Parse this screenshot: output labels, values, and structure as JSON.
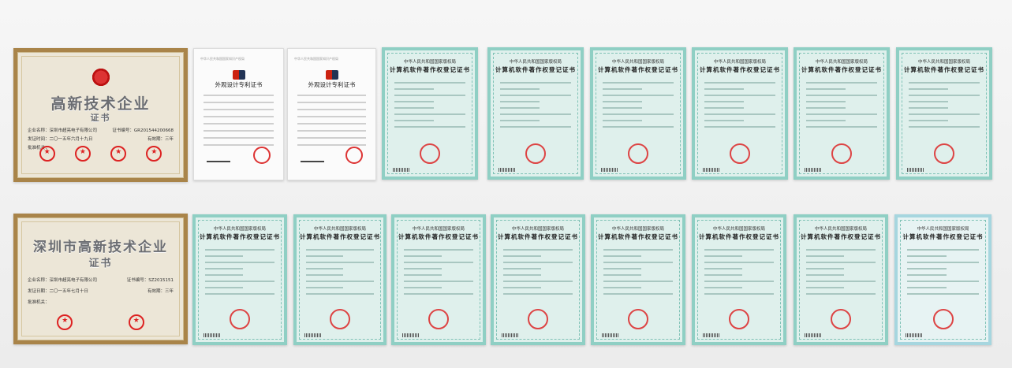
{
  "plaques": [
    {
      "title": "高新技术企业",
      "subtitle": "证书",
      "company_label": "企业名称：",
      "company": "深圳市超亮电子有限公司",
      "no_label": "证书编号：",
      "no": "GR201544200668",
      "date_label": "发证时间：",
      "date": "二〇一五年六月十九日",
      "validity_label": "有效期：",
      "validity": "三年",
      "issuer_label": "批准机关："
    },
    {
      "title": "深圳市高新技术企业",
      "subtitle": "证书",
      "company_label": "企业名称：",
      "company": "深圳市超亮电子有限公司",
      "no_label": "证书编号：",
      "no": "SZ2015151",
      "date_label": "发证日期：",
      "date": "二〇一五年七月十日",
      "validity_label": "有效期：",
      "validity": "三年",
      "issuer_label": "批准机关："
    }
  ],
  "patents": [
    {
      "org": "中华人民共和国国家知识产权局",
      "title": "外观设计专利证书"
    },
    {
      "org": "中华人民共和国国家知识产权局",
      "title": "外观设计专利证书"
    }
  ],
  "software_certs_row1": [
    {
      "org": "中华人民共和国国家版权局",
      "title": "计算机软件著作权登记证书"
    },
    {
      "org": "中华人民共和国国家版权局",
      "title": "计算机软件著作权登记证书"
    },
    {
      "org": "中华人民共和国国家版权局",
      "title": "计算机软件著作权登记证书"
    },
    {
      "org": "中华人民共和国国家版权局",
      "title": "计算机软件著作权登记证书"
    },
    {
      "org": "中华人民共和国国家版权局",
      "title": "计算机软件著作权登记证书"
    },
    {
      "org": "中华人民共和国国家版权局",
      "title": "计算机软件著作权登记证书"
    }
  ],
  "software_certs_row2": [
    {
      "org": "中华人民共和国国家版权局",
      "title": "计算机软件著作权登记证书"
    },
    {
      "org": "中华人民共和国国家版权局",
      "title": "计算机软件著作权登记证书"
    },
    {
      "org": "中华人民共和国国家版权局",
      "title": "计算机软件著作权登记证书"
    },
    {
      "org": "中华人民共和国国家版权局",
      "title": "计算机软件著作权登记证书"
    },
    {
      "org": "中华人民共和国国家版权局",
      "title": "计算机软件著作权登记证书"
    },
    {
      "org": "中华人民共和国国家版权局",
      "title": "计算机软件著作权登记证书"
    },
    {
      "org": "中华人民共和国国家版权局",
      "title": "计算机软件著作权登记证书"
    },
    {
      "org": "中华人民共和国国家版权局",
      "title": "计算机软件著作权登记证书"
    }
  ],
  "colors": {
    "frame_gold": "#a98449",
    "cert_teal": "#8fcfc4",
    "seal_red": "#d22"
  }
}
